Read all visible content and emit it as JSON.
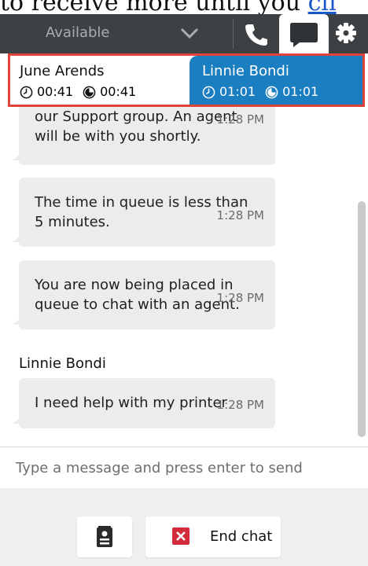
{
  "top_text": {
    "prefix": "to receive more until you ",
    "link": "cli"
  },
  "toolbar": {
    "status": "Available"
  },
  "contacts": [
    {
      "name": "June Arends",
      "timer1": "00:41",
      "timer2": "00:41",
      "active": false
    },
    {
      "name": "Linnie Bondi",
      "timer1": "01:01",
      "timer2": "01:01",
      "active": true
    }
  ],
  "messages": [
    {
      "text1": "our Support group. An agent",
      "text2": "will be with you shortly.",
      "time": "1:28 PM"
    },
    {
      "text1": "The time in queue is less than",
      "text2": "5 minutes.",
      "time": "1:28 PM"
    },
    {
      "text1": "You are now being placed in",
      "text2": "queue to chat with an agent.",
      "time": "1:28 PM"
    },
    {
      "text1": "I need help with my printer",
      "time": "1:28 PM"
    }
  ],
  "sender_name": "Linnie Bondi",
  "composer": {
    "placeholder": "Type a message and press enter to send"
  },
  "footer": {
    "end_chat_label": "End chat"
  },
  "colors": {
    "toolbar": "#3d4144",
    "active_contact": "#1a7ec0",
    "end_icon": "#d22b3a",
    "highlight": "#e0443a"
  }
}
